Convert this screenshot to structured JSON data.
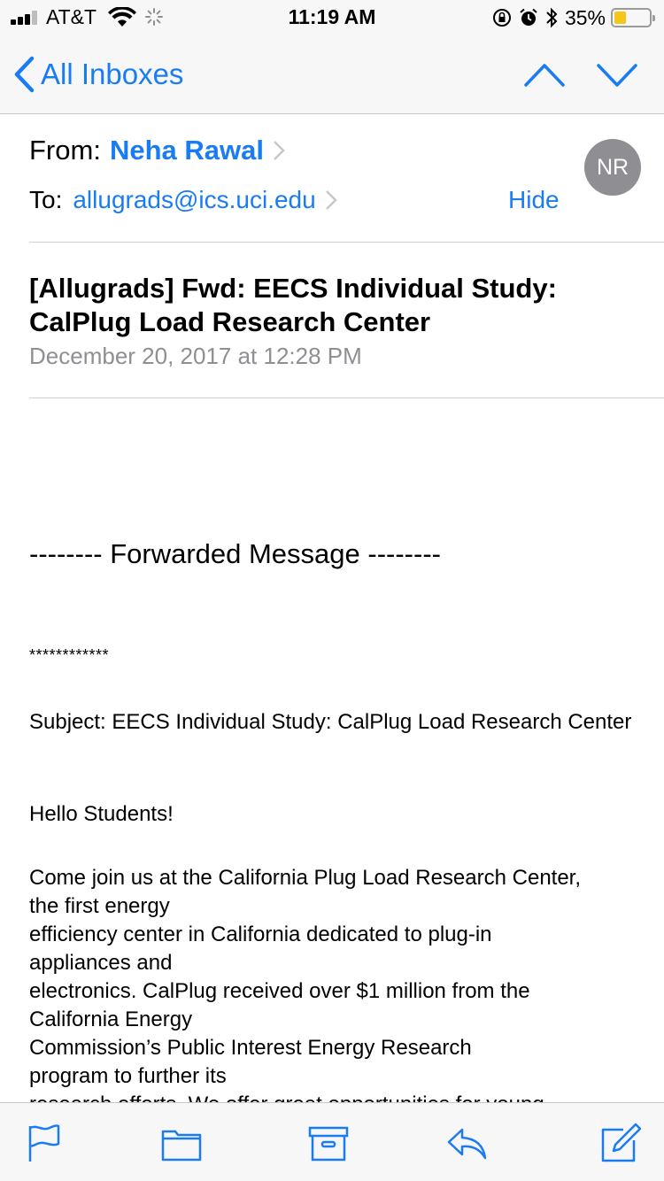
{
  "status_bar": {
    "carrier": "AT&T",
    "time": "11:19 AM",
    "battery_percent": "35%",
    "battery_level": 0.35,
    "icons": [
      "signal-icon",
      "wifi-icon",
      "activity-spinner-icon",
      "rotation-lock-icon",
      "alarm-icon",
      "bluetooth-icon",
      "battery-icon"
    ]
  },
  "nav": {
    "back_label": "All Inboxes",
    "icons": [
      "chevron-left-icon",
      "chevron-up-icon",
      "chevron-down-icon"
    ]
  },
  "header": {
    "from_label": "From:",
    "from_name": "Neha Rawal",
    "to_label": "To:",
    "to_address": "allugrads@ics.uci.edu",
    "hide_label": "Hide",
    "avatar_initials": "NR"
  },
  "email": {
    "subject": "[Allugrads] Fwd: EECS Individual Study: CalPlug Load Research Center",
    "date": "December 20, 2017 at 12:28 PM"
  },
  "body": {
    "forwarded": "-------- Forwarded Message --------",
    "stars": "************",
    "subject_line": "Subject: EECS Individual Study: CalPlug Load Research Center",
    "hello": "Hello Students!",
    "paragraph_lines": [
      "Come join us at the California Plug Load Research Center,",
      "the first energy",
      "efficiency center in California dedicated to plug-in",
      "appliances and",
      "electronics. CalPlug received over $1 million from the",
      "California Energy",
      "Commission’s Public Interest Energy Research",
      "program to further its",
      "research efforts. We offer great opportunities for young"
    ]
  },
  "toolbar": {
    "icons": [
      "flag-icon",
      "folder-icon",
      "archive-icon",
      "reply-icon",
      "compose-icon"
    ]
  },
  "colors": {
    "accent": "#1a7cf2",
    "bar_background": "#f7f7f7",
    "secondary_text": "#8e8e93",
    "avatar_bg": "#8e8e93",
    "battery_fill": "#f5c518"
  }
}
